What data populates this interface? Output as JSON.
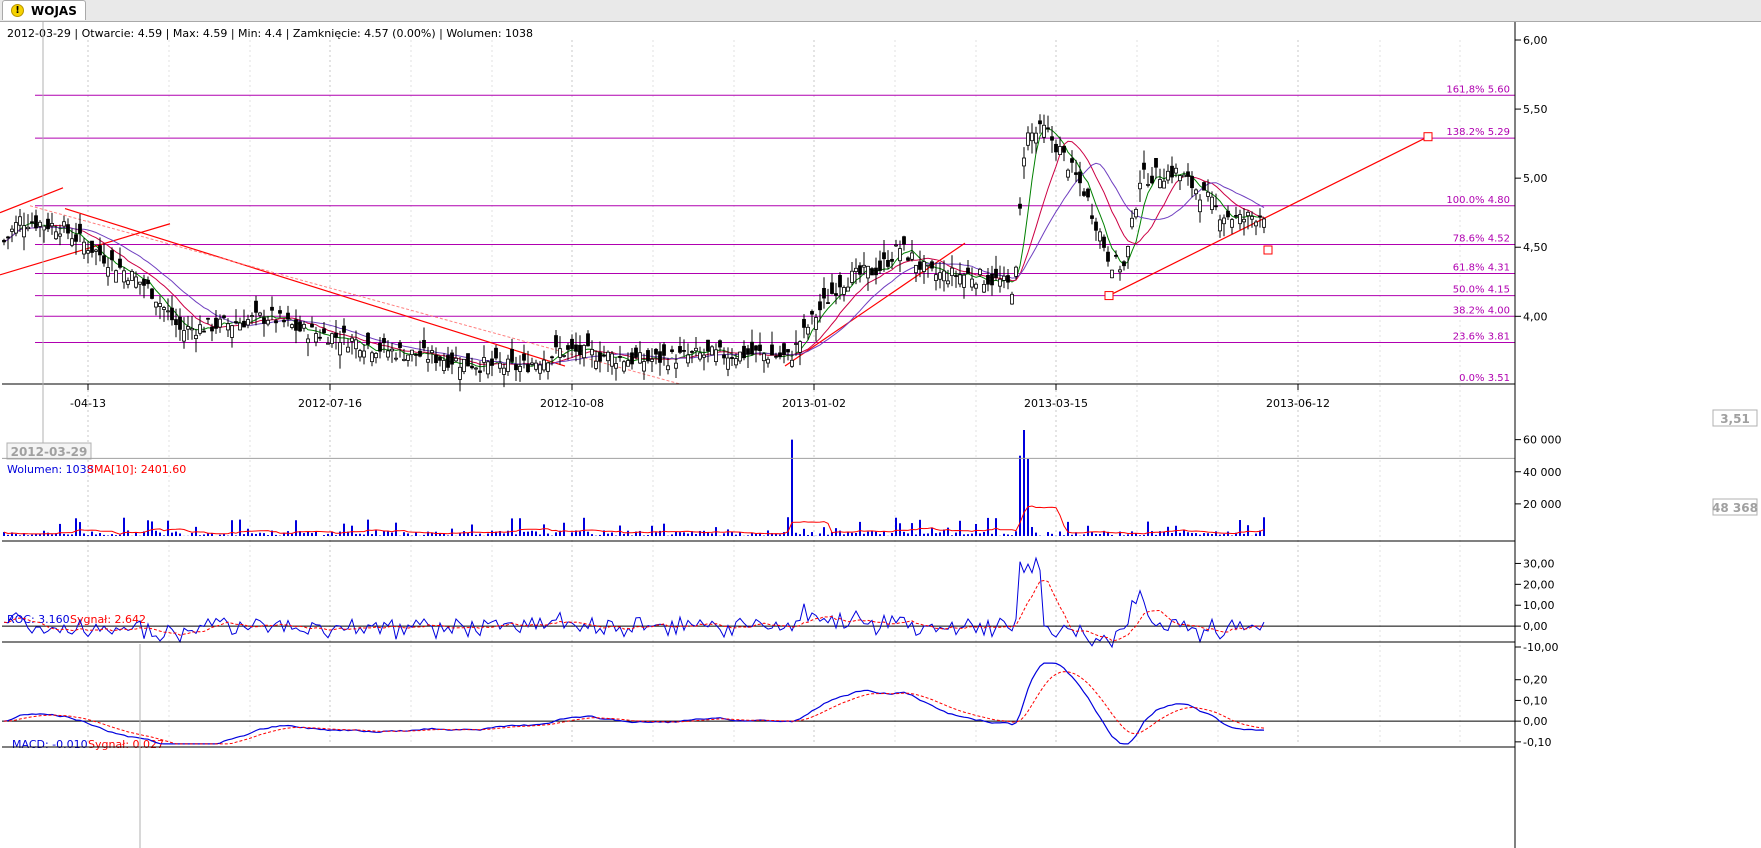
{
  "tab": {
    "label": "WOJAS",
    "icon": "warning-icon"
  },
  "colors": {
    "candle": "#000000",
    "fib": "#b000b0",
    "trend": "#ff0000",
    "ma_green": "#008000",
    "ma_crimson": "#cc0044",
    "ma_purple": "#7040c0",
    "volume": "#0000dd",
    "signal": "#ff0000",
    "grid": "#c8c8c8"
  },
  "price_panel": {
    "info": "2012-03-29 | Otwarcie: 4.59 | Max: 4.59 | Min: 4.4 | Zamknięcie: 4.57 (0.00%)  | Wolumen: 1038",
    "y_ticks": [
      "6,00",
      "5,50",
      "5,00",
      "4,50",
      "4,00"
    ],
    "current_label": "3,51",
    "x_ticks": [
      "-04-13",
      "2012-07-16",
      "2012-10-08",
      "2013-01-02",
      "2013-03-15",
      "2013-06-12"
    ],
    "cursor_date": "2012-03-29",
    "fib_labels": [
      "161,8% 5.60",
      "138.2% 5.29",
      "100.0% 4.80",
      "78.6% 4.52",
      "61.8% 4.31",
      "50.0% 4.15",
      "38.2% 4.00",
      "23.6% 3.81",
      "0.0% 3.51"
    ]
  },
  "volume_panel": {
    "label": "Wolumen: 1038",
    "sma_label": "SMA[10]: 2401.60",
    "y_ticks": [
      "60 000",
      "40 000",
      "20 000"
    ],
    "current_label": "48 368"
  },
  "roc_panel": {
    "label": "ROC: 3.160",
    "signal_label": "Sygnał: 2.642",
    "y_ticks": [
      "30,00",
      "20,00",
      "10,00",
      "0,00",
      "-10,00"
    ]
  },
  "macd_panel": {
    "label": "MACD: -0.010",
    "signal_label": "Sygnał: 0.027",
    "y_ticks": [
      "0,20",
      "0,10",
      "0,00",
      "-0,10"
    ]
  },
  "chart_data": [
    {
      "type": "candlestick",
      "title": "WOJAS",
      "x": [
        "2012-03-29",
        "2012-04-13",
        "2012-07-16",
        "2012-10-08",
        "2013-01-02",
        "2013-03-15",
        "2013-06-12"
      ],
      "close": [
        4.57,
        4.6,
        3.97,
        3.7,
        3.95,
        5.3,
        4.8
      ],
      "ylim": [
        3.51,
        6.0
      ],
      "fibonacci": [
        {
          "level": "0.0%",
          "value": 3.51
        },
        {
          "level": "23.6%",
          "value": 3.81
        },
        {
          "level": "38.2%",
          "value": 4.0
        },
        {
          "level": "50.0%",
          "value": 4.15
        },
        {
          "level": "61.8%",
          "value": 4.31
        },
        {
          "level": "78.6%",
          "value": 4.52
        },
        {
          "level": "100.0%",
          "value": 4.8
        },
        {
          "level": "138.2%",
          "value": 5.29
        },
        {
          "level": "161.8%",
          "value": 5.6
        }
      ],
      "grid": true
    },
    {
      "type": "bar",
      "series": [
        {
          "name": "Wolumen",
          "last": 1038
        },
        {
          "name": "SMA[10]",
          "last": 2401.6
        }
      ],
      "ylim": [
        0,
        60000
      ],
      "max_spikes": [
        {
          "x": "2013-01-02",
          "value": 60000
        },
        {
          "x": "2013-03-15",
          "value": 66000
        }
      ],
      "reference_level": 48368
    },
    {
      "type": "line",
      "series": [
        {
          "name": "ROC",
          "last": 3.16
        },
        {
          "name": "Sygnał",
          "last": 2.642
        }
      ],
      "ylim": [
        -10,
        30
      ]
    },
    {
      "type": "line",
      "series": [
        {
          "name": "MACD",
          "last": -0.01
        },
        {
          "name": "Sygnał",
          "last": 0.027
        }
      ],
      "ylim": [
        -0.1,
        0.3
      ]
    }
  ]
}
